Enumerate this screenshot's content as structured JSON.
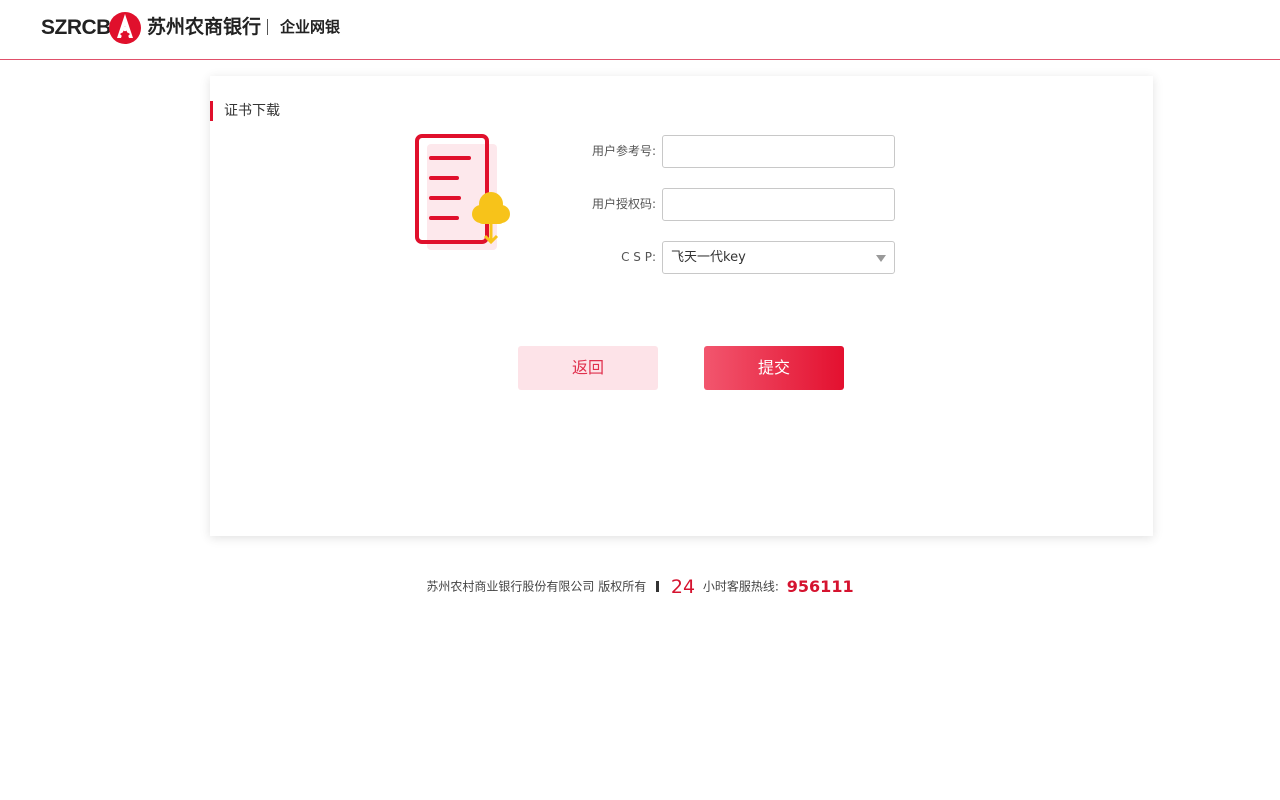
{
  "header": {
    "logo_en": "SZRCB",
    "logo_cn": "苏州农商银行",
    "subtitle": "企业网银",
    "brand_color": "#e0102c"
  },
  "card": {
    "section_title": "证书下载",
    "illustration_icon": "certificate-download-icon",
    "form": {
      "user_ref_label": "用户参考号:",
      "user_ref_value": "",
      "auth_code_label": "用户授权码:",
      "auth_code_value": "",
      "csp_label": "C S P:",
      "csp_selected": "飞天一代key"
    },
    "buttons": {
      "back": "返回",
      "submit": "提交"
    }
  },
  "footer": {
    "copyright": "苏州农村商业银行股份有限公司 版权所有",
    "hours": "24",
    "hotline_label": "小时客服热线:",
    "hotline_number": "956111"
  }
}
